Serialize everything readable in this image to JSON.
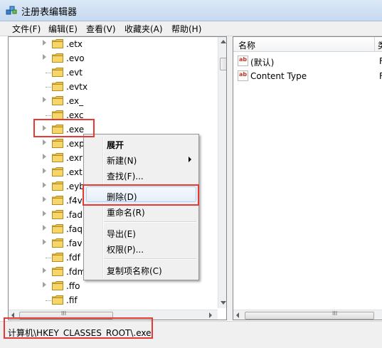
{
  "window": {
    "title": "注册表编辑器"
  },
  "menu": [
    "文件(F)",
    "编辑(E)",
    "查看(V)",
    "收藏夹(A)",
    "帮助(H)"
  ],
  "tree": {
    "items": [
      {
        "label": ".etx",
        "expandable": true
      },
      {
        "label": ".evo",
        "expandable": true
      },
      {
        "label": ".evt",
        "expandable": false
      },
      {
        "label": ".evtx",
        "expandable": false
      },
      {
        "label": ".ex_",
        "expandable": true
      },
      {
        "label": ".exc",
        "expandable": false
      },
      {
        "label": ".exe",
        "expandable": true
      },
      {
        "label": ".exp",
        "expandable": true
      },
      {
        "label": ".exr",
        "expandable": true
      },
      {
        "label": ".ext",
        "expandable": true
      },
      {
        "label": ".eyb",
        "expandable": true
      },
      {
        "label": ".f4v",
        "expandable": true
      },
      {
        "label": ".fad",
        "expandable": true
      },
      {
        "label": ".faq",
        "expandable": true
      },
      {
        "label": ".fav",
        "expandable": true
      },
      {
        "label": ".fdf",
        "expandable": false
      },
      {
        "label": ".fdm",
        "expandable": true
      },
      {
        "label": ".ffo",
        "expandable": true
      },
      {
        "label": ".fif",
        "expandable": false
      }
    ],
    "hscroll_glyph": "III"
  },
  "list": {
    "column_name": "名称",
    "column_type_truncated": "类",
    "rows": [
      {
        "name": "(默认)",
        "trunc": "F"
      },
      {
        "name": "Content Type",
        "trunc": "F"
      }
    ],
    "hscroll_glyph": "III"
  },
  "context_menu": {
    "expand": "展开",
    "new": "新建(N)",
    "find": "查找(F)...",
    "delete": "删除(D)",
    "rename": "重命名(R)",
    "export": "导出(E)",
    "permissions": "权限(P)...",
    "copy_key_name": "复制项名称(C)"
  },
  "status": {
    "path": "计算机\\HKEY_CLASSES_ROOT\\.exe"
  },
  "colors": {
    "highlight_box": "#e53935",
    "folder": "#e8c048"
  }
}
